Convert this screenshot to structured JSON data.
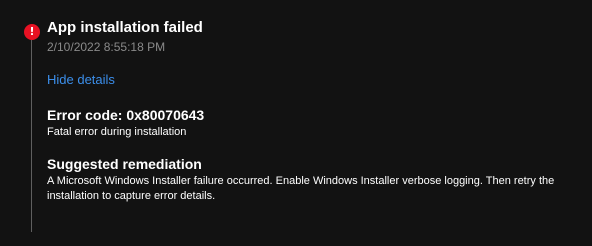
{
  "notification": {
    "title": "App installation failed",
    "timestamp": "2/10/2022 8:55:18 PM",
    "details_link": "Hide details",
    "status_color": "#e81123",
    "icon": "error-icon",
    "error_code_label": "Error code: 0x80070643",
    "error_description": "Fatal error during installation",
    "remediation_title": "Suggested remediation",
    "remediation_text": "A Microsoft Windows Installer failure occurred. Enable Windows Installer verbose logging. Then retry the installation to capture error details."
  }
}
